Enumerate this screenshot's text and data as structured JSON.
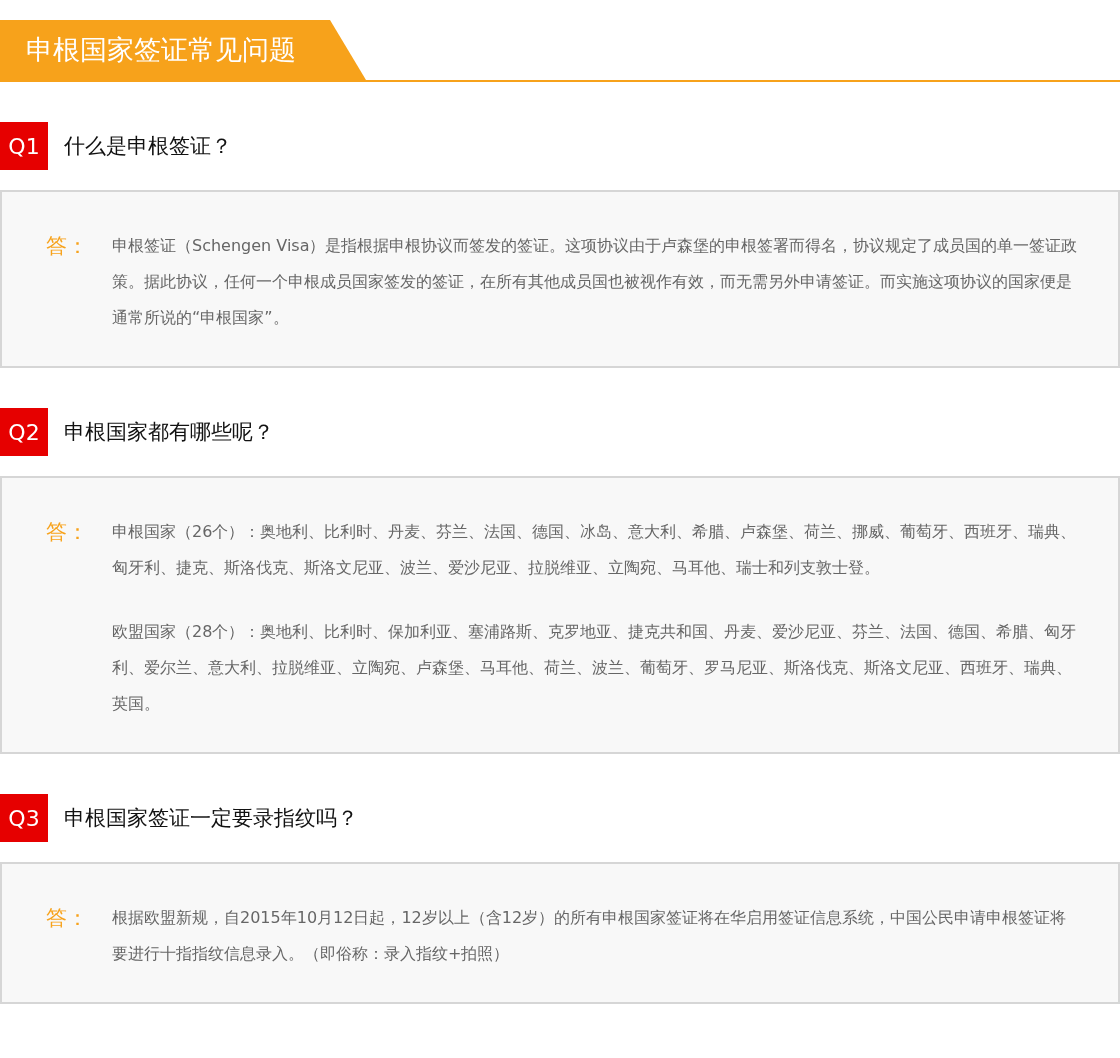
{
  "header": {
    "title": "申根国家签证常见问题"
  },
  "faqs": [
    {
      "badge": "Q1",
      "question": "什么是申根签证？",
      "answer_label": "答：",
      "paragraphs": [
        "申根签证（Schengen Visa）是指根据申根协议而签发的签证。这项协议由于卢森堡的申根签署而得名，协议规定了成员国的单一签证政策。据此协议，任何一个申根成员国家签发的签证，在所有其他成员国也被视作有效，而无需另外申请签证。而实施这项协议的国家便是通常所说的“申根国家”。"
      ]
    },
    {
      "badge": "Q2",
      "question": "申根国家都有哪些呢？",
      "answer_label": "答：",
      "paragraphs": [
        "申根国家（26个）：奥地利、比利时、丹麦、芬兰、法国、德国、冰岛、意大利、希腊、卢森堡、荷兰、挪威、葡萄牙、西班牙、瑞典、匈牙利、捷克、斯洛伐克、斯洛文尼亚、波兰、爱沙尼亚、拉脱维亚、立陶宛、马耳他、瑞士和列支敦士登。",
        "欧盟国家（28个）：奥地利、比利时、保加利亚、塞浦路斯、克罗地亚、捷克共和国、丹麦、爱沙尼亚、芬兰、法国、德国、希腊、匈牙利、爱尔兰、意大利、拉脱维亚、立陶宛、卢森堡、马耳他、荷兰、波兰、葡萄牙、罗马尼亚、斯洛伐克、斯洛文尼亚、西班牙、瑞典、英国。"
      ]
    },
    {
      "badge": "Q3",
      "question": "申根国家签证一定要录指纹吗？",
      "answer_label": "答：",
      "paragraphs": [
        "根据欧盟新规，自2015年10月12日起，12岁以上（含12岁）的所有申根国家签证将在华启用签证信息系统，中国公民申请申根签证将要进行十指指纹信息录入。（即俗称：录入指纹+拍照）"
      ]
    }
  ]
}
